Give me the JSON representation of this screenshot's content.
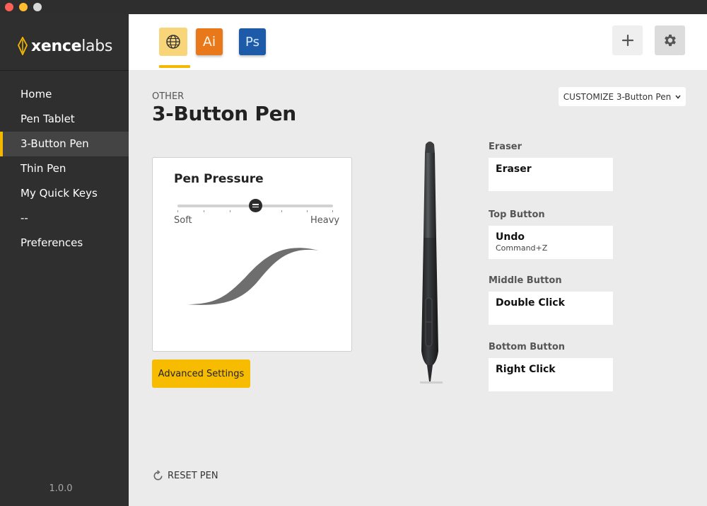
{
  "window": {
    "controls": [
      "close",
      "minimize",
      "maximize"
    ]
  },
  "sidebar": {
    "logo": {
      "icon": "xencelabs-nib-logo",
      "text_bold": "xence",
      "text_light": "labs",
      "accent": "#f5b800"
    },
    "items": [
      {
        "label": "Home",
        "active": false
      },
      {
        "label": "Pen Tablet",
        "active": false
      },
      {
        "label": "3-Button Pen",
        "active": true
      },
      {
        "label": "Thin Pen",
        "active": false
      },
      {
        "label": "My Quick Keys",
        "active": false
      },
      {
        "label": "--",
        "active": false
      },
      {
        "label": "Preferences",
        "active": false
      }
    ],
    "version": "1.0.0"
  },
  "topbar": {
    "app_tabs": [
      {
        "name": "global",
        "icon": "globe-icon",
        "label": "",
        "active": true,
        "color": "#f9d57a"
      },
      {
        "name": "illustrator",
        "icon": "illustrator-icon",
        "label": "Ai",
        "active": false,
        "color": "#e8781a"
      },
      {
        "name": "photoshop",
        "icon": "photoshop-icon",
        "label": "Ps",
        "active": false,
        "color": "#1d5aa8"
      }
    ],
    "add_icon": "plus-icon",
    "settings_icon": "gear-icon"
  },
  "page": {
    "eyebrow": "OTHER",
    "title": "3-Button Pen",
    "customize_label": "CUSTOMIZE 3-Button Pen"
  },
  "pressure": {
    "title": "Pen Pressure",
    "soft_label": "Soft",
    "heavy_label": "Heavy",
    "level": 0.5
  },
  "advanced_button": "Advanced Settings",
  "assignments": [
    {
      "label": "Eraser",
      "action": "Eraser",
      "shortcut": ""
    },
    {
      "label": "Top Button",
      "action": "Undo",
      "shortcut": "Command+Z"
    },
    {
      "label": "Middle Button",
      "action": "Double Click",
      "shortcut": ""
    },
    {
      "label": "Bottom Button",
      "action": "Right Click",
      "shortcut": ""
    }
  ],
  "reset_label": "RESET PEN",
  "colors": {
    "accent": "#f5b800",
    "sidebar": "#2f2f2f",
    "background": "#ebebeb"
  }
}
